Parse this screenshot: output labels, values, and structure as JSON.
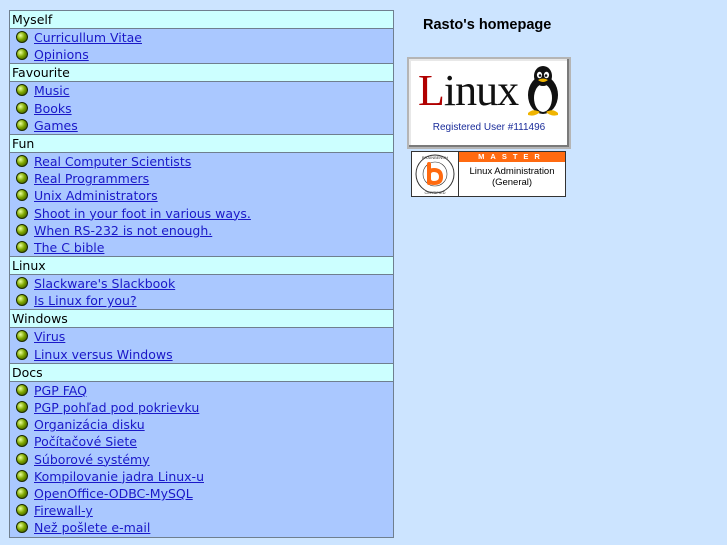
{
  "colors": {
    "page_background": "#cce4ff",
    "section_header": "#ccffff",
    "section_body": "#aac8ff",
    "link": "#1a18c8",
    "master_banner": "#ff6a10"
  },
  "header": {
    "title": "Rasto's homepage"
  },
  "badges": {
    "linux": {
      "logo_first_letter": "L",
      "logo_rest": "inux",
      "registered_user": "Registered User #111496",
      "icon": "tux-penguin-icon"
    },
    "brainbench": {
      "seal_text": "BRAINBENCH CERTIFIED",
      "level": "MASTER",
      "cert_line1": "Linux Administration",
      "cert_line2": "(General)"
    }
  },
  "menu": {
    "sections": [
      {
        "title": "Myself",
        "items": [
          "Curricullum Vitae",
          "Opinions"
        ]
      },
      {
        "title": "Favourite",
        "items": [
          "Music",
          "Books",
          "Games"
        ]
      },
      {
        "title": "Fun",
        "items": [
          "Real Computer Scientists",
          "Real Programmers",
          "Unix Administrators",
          "Shoot in your foot in various ways.",
          "When RS-232 is not enough.",
          "The C bible"
        ]
      },
      {
        "title": "Linux",
        "items": [
          "Slackware's Slackbook",
          "Is Linux for you?"
        ]
      },
      {
        "title": "Windows",
        "items": [
          "Virus",
          "Linux versus Windows"
        ]
      },
      {
        "title": "Docs",
        "items": [
          "PGP FAQ",
          "PGP pohľad pod pokrievku",
          "Organizácia disku",
          "Počítačové Siete",
          "Súborové systémy",
          "Kompilovanie jadra Linux-u",
          "OpenOffice-ODBC-MySQL",
          "Firewall-y",
          "Než pošlete e-mail"
        ]
      }
    ]
  }
}
